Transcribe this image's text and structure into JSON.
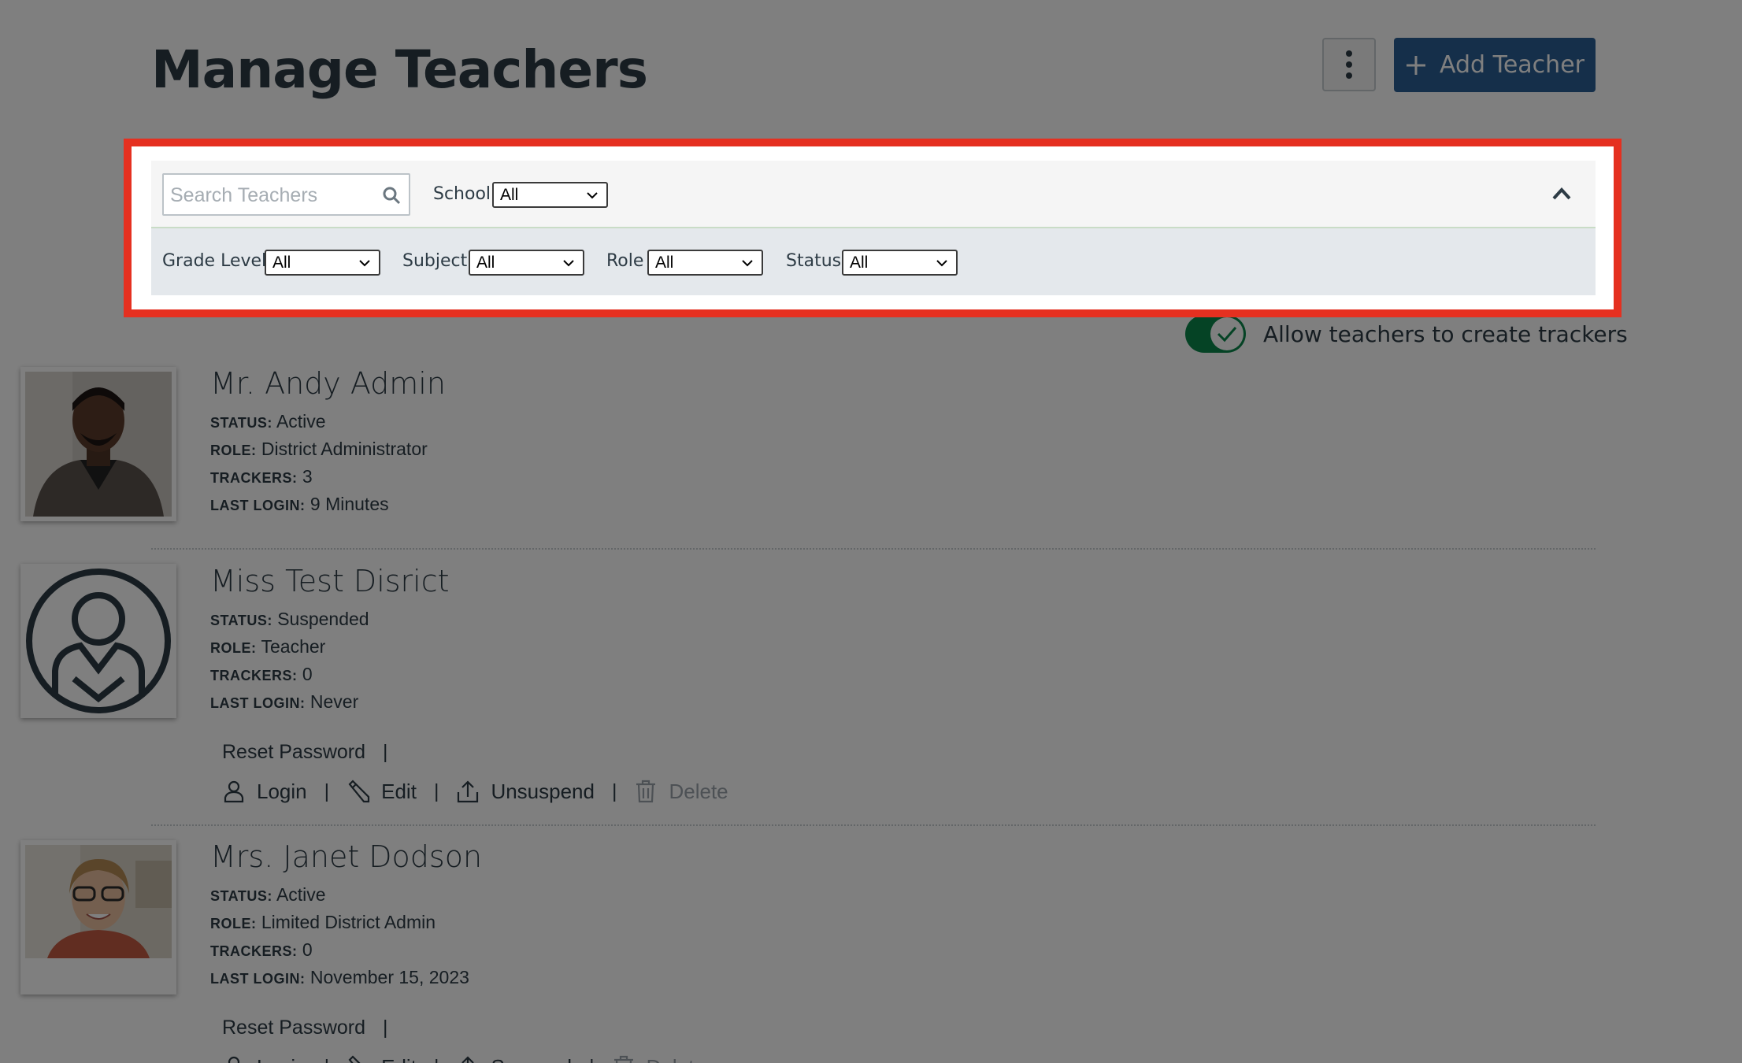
{
  "header": {
    "title": "Manage Teachers",
    "more_icon": "kebab-vertical-icon",
    "add_button_label": "Add Teacher",
    "add_icon": "plus-icon"
  },
  "filters": {
    "search_placeholder": "Search Teachers",
    "search_value": "",
    "school_label": "School",
    "school_value": "All",
    "grade_label": "Grade Level",
    "grade_value": "All",
    "subject_label": "Subject",
    "subject_value": "All",
    "role_label": "Role",
    "role_value": "All",
    "status_label": "Status",
    "status_value": "All",
    "collapse_icon": "chevron-up-icon"
  },
  "toggle": {
    "label": "Allow teachers to create trackers",
    "on": true,
    "color": "#0b874b"
  },
  "labels": {
    "status": "STATUS:",
    "role": "ROLE:",
    "trackers": "TRACKERS:",
    "last_login": "LAST LOGIN:",
    "reset_password": "Reset Password",
    "separator": "|",
    "login": "Login",
    "edit": "Edit",
    "delete": "Delete"
  },
  "teachers": [
    {
      "name": "Mr. Andy Admin",
      "status": "Active",
      "role": "District Administrator",
      "trackers": "3",
      "last_login": "9 Minutes",
      "photo": "man-portrait-photo"
    },
    {
      "name": "Miss Test Disrict",
      "status": "Suspended",
      "role": "Teacher",
      "trackers": "0",
      "last_login": "Never",
      "photo": "default-avatar-icon",
      "suspend_action": "Unsuspend"
    },
    {
      "name": "Mrs. Janet Dodson",
      "status": "Active",
      "role": "Limited District Admin",
      "trackers": "0",
      "last_login": "November 15, 2023",
      "photo": "woman-portrait-photo",
      "suspend_action": "Suspend"
    }
  ],
  "colors": {
    "primary": "#2b5f94",
    "highlight": "#e53020",
    "text": "#2d3b45"
  }
}
